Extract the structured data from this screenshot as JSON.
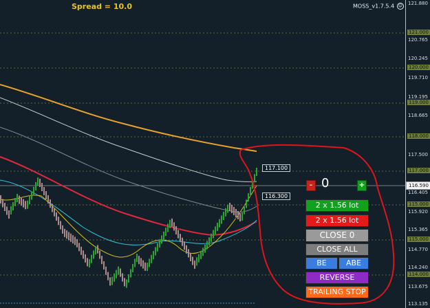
{
  "header": {
    "spread": "Spread = 10.0",
    "ea_name": "MOSS_v1.7.5.4",
    "smile": "☺"
  },
  "price_axis": {
    "ticks": [
      "121.880",
      "120.765",
      "120.245",
      "119.710",
      "119.195",
      "118.665",
      "117.500",
      "116.405",
      "115.920",
      "115.365",
      "114.770",
      "114.240",
      "113.675",
      "113.135"
    ],
    "level_tags": [
      "121.000",
      "120.000",
      "119.000",
      "118.000",
      "117.000",
      "115.000",
      "115.000",
      "114.000"
    ],
    "current_price": "116.590"
  },
  "callouts": {
    "upper": "117.100",
    "lower": "116.300"
  },
  "panel": {
    "minus_label": "-",
    "plus_label": "+",
    "counter": "0",
    "buy_label": "2 x 1.56 lot",
    "sell_label": "2 x 1.56 lot",
    "close_label": "CLOSE 0",
    "close_all_label": "CLOSE ALL",
    "be_label": "BE",
    "abe_label": "ABE",
    "reverse_label": "REVERSE",
    "trailing_label": "TRAILING STOP"
  },
  "colors": {
    "background": "#142029",
    "spread_text": "#e8c21d",
    "ma_orange": "#e8a32a",
    "ma_white": "#c9cfd3",
    "ma_gray": "#7d8a92",
    "ma_red": "#e0283a",
    "ma_cyan": "#2fc4dc",
    "ma_yellow": "#d8c21a",
    "bull_bar": "#33d63a",
    "bear_bar": "#e2b6b6",
    "buy_button": "#11a11e",
    "sell_button": "#e41b1b",
    "close_button": "#9a9a9a",
    "close_all_button": "#7d7d7d",
    "be_button": "#3a7de0",
    "reverse_button": "#8e2bc6",
    "trailing_button": "#ff6a1a",
    "annotation": "#e0141a"
  }
}
